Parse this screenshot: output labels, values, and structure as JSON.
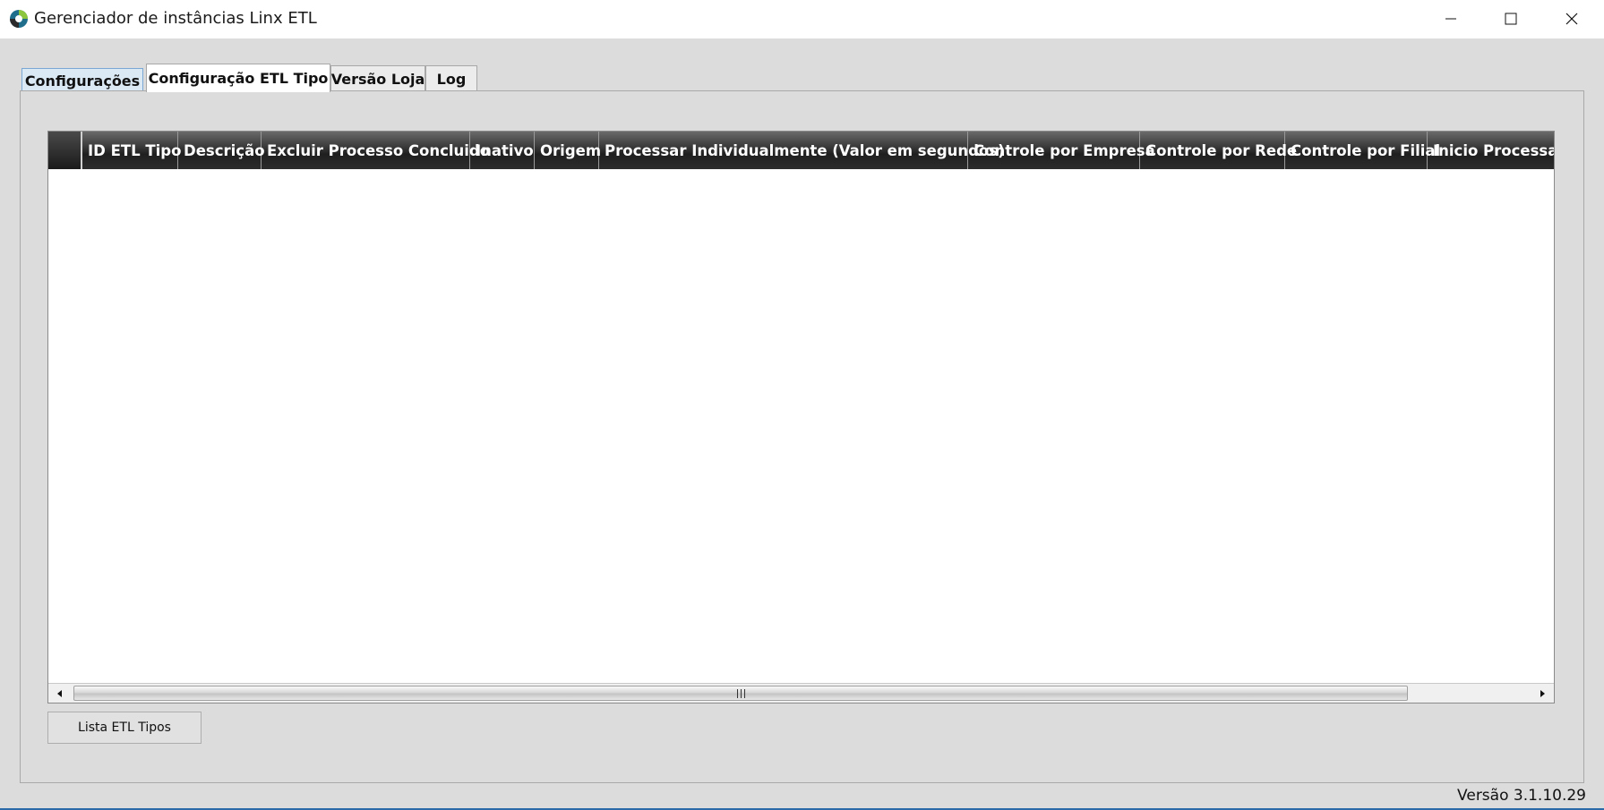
{
  "window": {
    "title": "Gerenciador de instâncias Linx ETL",
    "icon": "linx-etl-app-icon"
  },
  "tabs": [
    {
      "label": "Configurações",
      "state": "inactive"
    },
    {
      "label": "Configuração ETL Tipo",
      "state": "active"
    },
    {
      "label": "Versão Loja",
      "state": "inactive"
    },
    {
      "label": "Log",
      "state": "inactive"
    }
  ],
  "grid": {
    "columns": [
      "ID ETL Tipo",
      "Descrição",
      "Excluir Processo Concluido",
      "Inativo",
      "Origem",
      "Processar Individualmente (Valor em segundos)",
      "Controle por Empresa",
      "Controle por Rede",
      "Controle por Filial",
      "Inicio Processar"
    ],
    "rows": []
  },
  "buttons": {
    "list_etl_types": "Lista ETL Tipos"
  },
  "status": {
    "version": "Versão 3.1.10.29"
  }
}
